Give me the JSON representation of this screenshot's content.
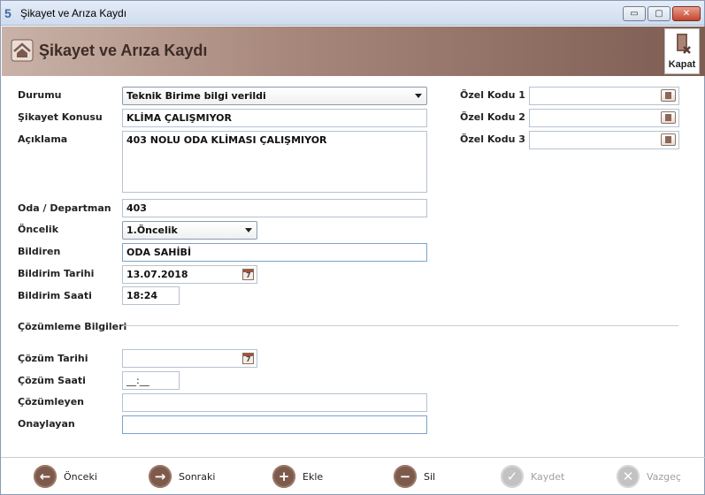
{
  "window": {
    "title": "Şikayet ve Arıza Kaydı",
    "app_icon": "5",
    "controls": {
      "minimize": "▭",
      "maximize": "▢",
      "close": "✕"
    }
  },
  "header": {
    "title": "Şikayet ve Arıza Kaydı",
    "close_label": "Kapat"
  },
  "form": {
    "durumu": {
      "label": "Durumu",
      "value": "Teknik Birime bilgi verildi"
    },
    "sikayet_konusu": {
      "label": "Şikayet Konusu",
      "value": "KLİMA ÇALIŞMIYOR"
    },
    "aciklama": {
      "label": "Açıklama",
      "value": "403 NOLU ODA KLİMASI ÇALIŞMIYOR"
    },
    "oda_departman": {
      "label": "Oda / Departman",
      "value": "403"
    },
    "oncelik": {
      "label": "Öncelik",
      "value": "1.Öncelik"
    },
    "bildiren": {
      "label": "Bildiren",
      "value": "ODA SAHİBİ"
    },
    "bildirim_tarihi": {
      "label": "Bildirim Tarihi",
      "value": "13.07.2018"
    },
    "bildirim_saati": {
      "label": "Bildirim Saati",
      "value": "18:24"
    },
    "ozel_kod_1": {
      "label": "Özel Kodu 1",
      "value": ""
    },
    "ozel_kod_2": {
      "label": "Özel Kodu 2",
      "value": ""
    },
    "ozel_kod_3": {
      "label": "Özel Kodu 3",
      "value": ""
    }
  },
  "resolution": {
    "section_title": "Çözümleme Bilgileri",
    "cozum_tarihi": {
      "label": "Çözüm Tarihi",
      "value": "  .  ."
    },
    "cozum_saati": {
      "label": "Çözüm Saati",
      "value": "__:__"
    },
    "cozumleyen": {
      "label": "Çözümleyen",
      "value": ""
    },
    "onaylayan": {
      "label": "Onaylayan",
      "value": ""
    }
  },
  "nav": {
    "onceki": {
      "label": "Önceki",
      "icon": "arrow-left-icon"
    },
    "sonraki": {
      "label": "Sonraki",
      "icon": "arrow-right-icon"
    },
    "ekle": {
      "label": "Ekle",
      "icon": "plus-icon"
    },
    "sil": {
      "label": "Sil",
      "icon": "minus-icon"
    },
    "kaydet": {
      "label": "Kaydet",
      "icon": "check-icon"
    },
    "vazgec": {
      "label": "Vazgeç",
      "icon": "x-icon"
    }
  },
  "colors": {
    "header_start": "#c9b2a8",
    "header_end": "#7d5d52",
    "nav_button": "#7d5a4c",
    "disabled": "#c2c2c2"
  }
}
